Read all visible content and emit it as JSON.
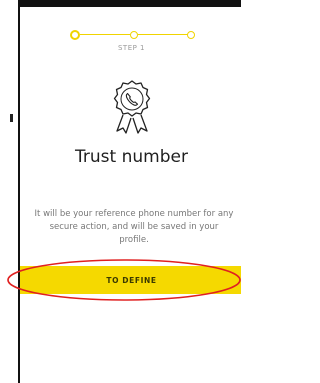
{
  "stepper": {
    "label": "STEP 1",
    "accent": "#f0d400"
  },
  "badge": {
    "icon": "phone-badge-icon"
  },
  "header": {
    "title": "Trust number"
  },
  "body": {
    "description": "It will be your reference phone number for any secure action, and will be saved in your profile."
  },
  "cta": {
    "label": "TO DEFINE",
    "color": "#f5d900",
    "annotation_color": "#e02020"
  }
}
